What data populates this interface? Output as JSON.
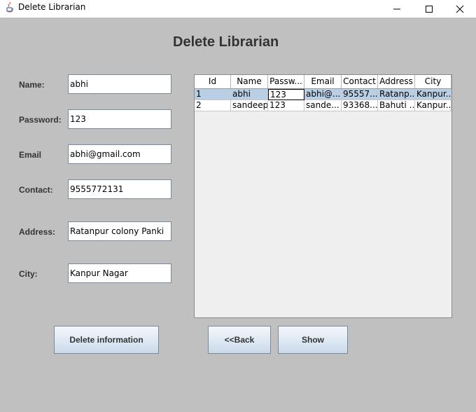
{
  "window": {
    "title": "Delete Librarian",
    "minimize_glyph": "—",
    "maximize_glyph": "☐",
    "close_glyph": "✕"
  },
  "heading": "Delete Librarian",
  "form": {
    "name": {
      "label": "Name:",
      "value": "abhi"
    },
    "password": {
      "label": "Password:",
      "value": "123"
    },
    "email": {
      "label": "Email",
      "value": "abhi@gmail.com"
    },
    "contact": {
      "label": "Contact:",
      "value": "9555772131"
    },
    "address": {
      "label": "Address:",
      "value": "Ratanpur colony Panki"
    },
    "city": {
      "label": "City:",
      "value": "Kanpur Nagar"
    }
  },
  "table": {
    "columns": [
      "Id",
      "Name",
      "Passw...",
      "Email",
      "Contact",
      "Address",
      "City"
    ],
    "rows": [
      [
        "1",
        "abhi",
        "123",
        "abhi@...",
        "95557...",
        "Ratanp...",
        "Kanpur..."
      ],
      [
        "2",
        "sandeep",
        "123",
        "sande...",
        "93368...",
        "Bahuti ...",
        "Kanpur..."
      ]
    ]
  },
  "buttons": {
    "delete": "Delete information",
    "back": "<<Back",
    "show": "Show"
  },
  "colors": {
    "background": "#c0c0c0",
    "selected_row": "#b8cfe5",
    "button_top": "#f3f7fb",
    "button_bottom": "#c9d9ea"
  }
}
